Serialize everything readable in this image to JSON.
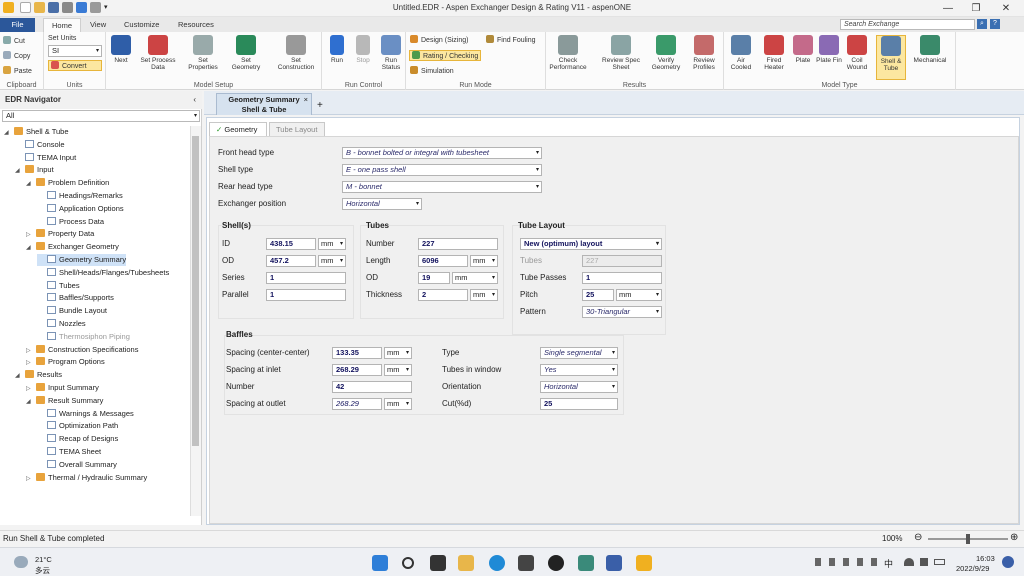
{
  "window": {
    "title": "Untitled.EDR - Aspen Exchanger Design & Rating V11 - aspenONE",
    "minimize": "—",
    "maximize": "❐",
    "close": "✕"
  },
  "ribbon_tabs": [
    "File",
    "Home",
    "View",
    "Customize",
    "Resources"
  ],
  "search": {
    "placeholder": "Search Exchange"
  },
  "clipboard": {
    "cut": "Cut",
    "copy": "Copy",
    "paste": "Paste",
    "label": "Clipboard"
  },
  "units": {
    "set_units": "Set Units",
    "value": "SI",
    "convert": "Convert",
    "label": "Units"
  },
  "model_setup": {
    "next": "Next",
    "set_process_data": "Set Process Data",
    "set_properties": "Set Properties",
    "set_geometry": "Set Geometry",
    "set_construction": "Set Construction",
    "label": "Model Setup"
  },
  "run_control": {
    "run": "Run",
    "stop": "Stop",
    "run_status": "Run Status",
    "label": "Run Control"
  },
  "run_mode": {
    "design": "Design (Sizing)",
    "rating": "Rating / Checking",
    "simulation": "Simulation",
    "find_fouling": "Find Fouling",
    "label": "Run Mode"
  },
  "results": {
    "check_performance": "Check Performance",
    "review_spec_sheet": "Review Spec Sheet",
    "verify_geometry": "Verify Geometry",
    "review_profiles": "Review Profiles",
    "label": "Results"
  },
  "model_type": {
    "air_cooled": "Air Cooled",
    "fired_heater": "Fired Heater",
    "plate": "Plate",
    "plate_fin": "Plate Fin",
    "coil_wound": "Coil Wound",
    "shell_tube": "Shell & Tube",
    "mechanical": "Mechanical",
    "label": "Model Type"
  },
  "navigator": {
    "title": "EDR Navigator",
    "filter": "All",
    "collapse": "‹"
  },
  "tree": [
    {
      "label": "Shell & Tube",
      "depth": 0,
      "arrow": "◢",
      "icon": "fold"
    },
    {
      "label": "Console",
      "depth": 1,
      "arrow": "",
      "icon": "pg"
    },
    {
      "label": "TEMA Input",
      "depth": 1,
      "arrow": "",
      "icon": "pg"
    },
    {
      "label": "Input",
      "depth": 1,
      "arrow": "◢",
      "icon": "fold"
    },
    {
      "label": "Problem Definition",
      "depth": 2,
      "arrow": "◢",
      "icon": "fold"
    },
    {
      "label": "Headings/Remarks",
      "depth": 3,
      "arrow": "",
      "icon": "pg"
    },
    {
      "label": "Application Options",
      "depth": 3,
      "arrow": "",
      "icon": "pg"
    },
    {
      "label": "Process Data",
      "depth": 3,
      "arrow": "",
      "icon": "pg"
    },
    {
      "label": "Property Data",
      "depth": 2,
      "arrow": "▷",
      "icon": "fold"
    },
    {
      "label": "Exchanger Geometry",
      "depth": 2,
      "arrow": "◢",
      "icon": "fold"
    },
    {
      "label": "Geometry Summary",
      "depth": 3,
      "arrow": "",
      "icon": "pg",
      "sel": true
    },
    {
      "label": "Shell/Heads/Flanges/Tubesheets",
      "depth": 3,
      "arrow": "",
      "icon": "pg"
    },
    {
      "label": "Tubes",
      "depth": 3,
      "arrow": "",
      "icon": "pg"
    },
    {
      "label": "Baffles/Supports",
      "depth": 3,
      "arrow": "",
      "icon": "pg"
    },
    {
      "label": "Bundle Layout",
      "depth": 3,
      "arrow": "",
      "icon": "pg"
    },
    {
      "label": "Nozzles",
      "depth": 3,
      "arrow": "",
      "icon": "pg"
    },
    {
      "label": "Thermosiphon Piping",
      "depth": 3,
      "arrow": "",
      "icon": "pg",
      "dim": true
    },
    {
      "label": "Construction Specifications",
      "depth": 2,
      "arrow": "▷",
      "icon": "fold"
    },
    {
      "label": "Program Options",
      "depth": 2,
      "arrow": "▷",
      "icon": "fold"
    },
    {
      "label": "Results",
      "depth": 1,
      "arrow": "◢",
      "icon": "fold"
    },
    {
      "label": "Input Summary",
      "depth": 2,
      "arrow": "▷",
      "icon": "fold"
    },
    {
      "label": "Result Summary",
      "depth": 2,
      "arrow": "◢",
      "icon": "fold"
    },
    {
      "label": "Warnings & Messages",
      "depth": 3,
      "arrow": "",
      "icon": "pg"
    },
    {
      "label": "Optimization Path",
      "depth": 3,
      "arrow": "",
      "icon": "pg"
    },
    {
      "label": "Recap of Designs",
      "depth": 3,
      "arrow": "",
      "icon": "pg"
    },
    {
      "label": "TEMA Sheet",
      "depth": 3,
      "arrow": "",
      "icon": "pg"
    },
    {
      "label": "Overall Summary",
      "depth": 3,
      "arrow": "",
      "icon": "pg"
    },
    {
      "label": "Thermal / Hydraulic Summary",
      "depth": 2,
      "arrow": "▷",
      "icon": "fold"
    }
  ],
  "doc_tab": {
    "line1": "Geometry Summary",
    "line2": "Shell & Tube",
    "close": "×",
    "add": "+"
  },
  "subtabs": {
    "geometry": "Geometry",
    "tube_layout": "Tube Layout",
    "check": "✓"
  },
  "form": {
    "front_head_label": "Front head type",
    "front_head_value": "B - bonnet bolted or integral with tubesheet",
    "shell_type_label": "Shell type",
    "shell_type_value": "E - one pass shell",
    "rear_head_label": "Rear head type",
    "rear_head_value": "M - bonnet",
    "position_label": "Exchanger position",
    "position_value": "Horizontal"
  },
  "shell": {
    "title": "Shell(s)",
    "id_label": "ID",
    "id_value": "438.15",
    "id_unit": "mm",
    "od_label": "OD",
    "od_value": "457.2",
    "od_unit": "mm",
    "series_label": "Series",
    "series_value": "1",
    "parallel_label": "Parallel",
    "parallel_value": "1"
  },
  "tubes": {
    "title": "Tubes",
    "number_label": "Number",
    "number_value": "227",
    "length_label": "Length",
    "length_value": "6096",
    "length_unit": "mm",
    "od_label": "OD",
    "od_value": "19",
    "od_unit": "mm",
    "thickness_label": "Thickness",
    "thickness_value": "2",
    "thickness_unit": "mm"
  },
  "tube_layout": {
    "title": "Tube Layout",
    "layout_value": "New (optimum) layout",
    "tubes_label": "Tubes",
    "tubes_value": "227",
    "passes_label": "Tube Passes",
    "passes_value": "1",
    "pitch_label": "Pitch",
    "pitch_value": "25",
    "pitch_unit": "mm",
    "pattern_label": "Pattern",
    "pattern_value": "30-Triangular"
  },
  "baffles": {
    "title": "Baffles",
    "spacing_cc_label": "Spacing (center-center)",
    "spacing_cc_value": "133.35",
    "spacing_cc_unit": "mm",
    "spacing_inlet_label": "Spacing at inlet",
    "spacing_inlet_value": "268.29",
    "spacing_inlet_unit": "mm",
    "number_label": "Number",
    "number_value": "42",
    "spacing_outlet_label": "Spacing at outlet",
    "spacing_outlet_value": "268.29",
    "spacing_outlet_unit": "mm",
    "type_label": "Type",
    "type_value": "Single segmental",
    "tubes_window_label": "Tubes in window",
    "tubes_window_value": "Yes",
    "orientation_label": "Orientation",
    "orientation_value": "Horizontal",
    "cut_label": "Cut(%d)",
    "cut_value": "25"
  },
  "status": {
    "message": "Run Shell & Tube completed",
    "zoom": "100%",
    "minus": "⊖",
    "plus": "⊕"
  },
  "taskbar": {
    "temp": "21°C",
    "weather": "多云",
    "ime": "中",
    "time": "16:03",
    "date": "2022/9/29"
  },
  "colors": {
    "accent": "#2b579a",
    "highlight": "#fce7a0",
    "selection": "#cfe2f7"
  }
}
